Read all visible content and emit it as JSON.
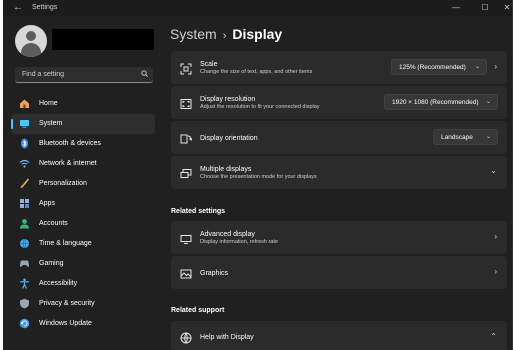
{
  "window": {
    "title": "Settings",
    "back_glyph": "←",
    "minimize_glyph": "—",
    "maximize_glyph": "☐",
    "close_glyph": "✕"
  },
  "sidebar": {
    "search_placeholder": "Find a setting",
    "items": [
      {
        "label": "Home",
        "icon": "home-icon",
        "color": "#e8a55a"
      },
      {
        "label": "System",
        "icon": "system-icon",
        "color": "#4cc2ff",
        "active": true
      },
      {
        "label": "Bluetooth & devices",
        "icon": "bluetooth-icon",
        "color": "#3a8ee6"
      },
      {
        "label": "Network & internet",
        "icon": "wifi-icon",
        "color": "#6fb3ea"
      },
      {
        "label": "Personalization",
        "icon": "brush-icon",
        "color": "#e08a48"
      },
      {
        "label": "Apps",
        "icon": "apps-icon",
        "color": "#8ab4e8"
      },
      {
        "label": "Accounts",
        "icon": "accounts-icon",
        "color": "#38b27b"
      },
      {
        "label": "Time & language",
        "icon": "globe-icon",
        "color": "#4aa8e8"
      },
      {
        "label": "Gaming",
        "icon": "gaming-icon",
        "color": "#9aa5b3"
      },
      {
        "label": "Accessibility",
        "icon": "accessibility-icon",
        "color": "#5ab4f0"
      },
      {
        "label": "Privacy & security",
        "icon": "shield-icon",
        "color": "#9aa5b3"
      },
      {
        "label": "Windows Update",
        "icon": "update-icon",
        "color": "#3a9ae6"
      }
    ]
  },
  "breadcrumb": {
    "parent": "System",
    "separator": "›",
    "current": "Display"
  },
  "settings": {
    "scale": {
      "title": "Scale",
      "subtitle": "Change the size of text, apps, and other items",
      "value": "125% (Recommended)"
    },
    "resolution": {
      "title": "Display resolution",
      "subtitle": "Adjust the resolution to fit your connected display",
      "value": "1920 × 1080 (Recommended)"
    },
    "orientation": {
      "title": "Display orientation",
      "value": "Landscape"
    },
    "multiple": {
      "title": "Multiple displays",
      "subtitle": "Choose the presentation mode for your displays"
    }
  },
  "related_settings": {
    "heading": "Related settings",
    "advanced": {
      "title": "Advanced display",
      "subtitle": "Display information, refresh rate"
    },
    "graphics": {
      "title": "Graphics"
    }
  },
  "related_support": {
    "heading": "Related support",
    "help": {
      "title": "Help with Display"
    }
  },
  "glyphs": {
    "chevron_right": "›",
    "chevron_down": "⌄",
    "chevron_up": "⌃",
    "search": "⌕"
  },
  "colors": {
    "accent": "#4cc2ff",
    "background": "#202020",
    "card": "#2b2b2b"
  }
}
